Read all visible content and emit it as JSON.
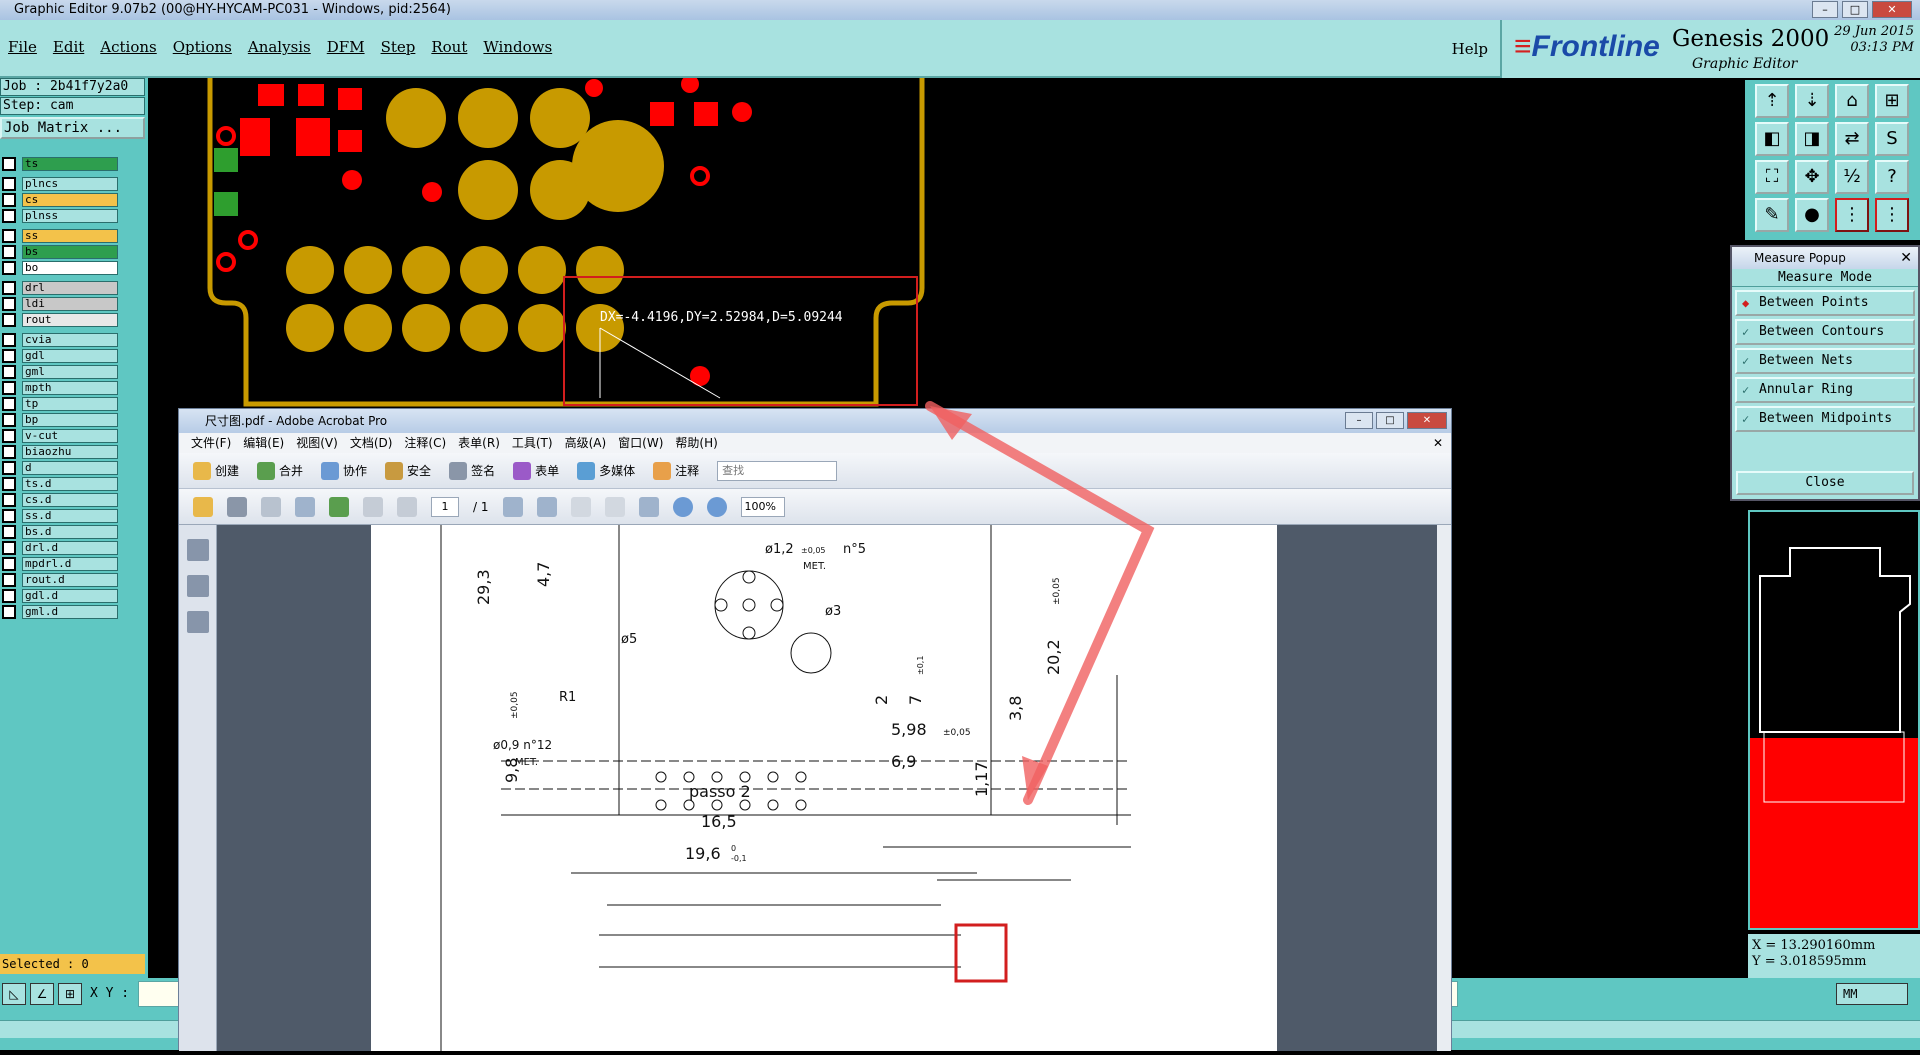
{
  "window": {
    "title": "Graphic Editor 9.07b2 (00@HY-HYCAM-PC031 - Windows, pid:2564)",
    "btn_min": "–",
    "btn_max": "□",
    "btn_close": "✕"
  },
  "menu": {
    "items": [
      "File",
      "Edit",
      "Actions",
      "Options",
      "Analysis",
      "DFM",
      "Step",
      "Rout",
      "Windows"
    ],
    "help": "Help"
  },
  "brand": {
    "logo": "Frontline",
    "product": "Genesis 2000",
    "subtitle": "Graphic Editor",
    "date": "29 Jun 2015",
    "time": "03:13 PM"
  },
  "left": {
    "job": "Job : 2b41f7y2a0",
    "step": "Step: cam",
    "job_matrix": "Job Matrix ...",
    "layers": [
      {
        "name": "ts",
        "color": "#2e9e4e"
      },
      {
        "name": "plncs",
        "color": "#a8e2e0"
      },
      {
        "name": "cs",
        "color": "#f3c24a"
      },
      {
        "name": "plnss",
        "color": "#a8e2e0"
      },
      {
        "name": "ss",
        "color": "#f3c24a"
      },
      {
        "name": "bs",
        "color": "#2e9e4e"
      },
      {
        "name": "bo",
        "color": "#ffffff"
      },
      {
        "name": "drl",
        "color": "#c8c8c8"
      },
      {
        "name": "ldi",
        "color": "#c8c8c8"
      },
      {
        "name": "rout",
        "color": "#e8e8e8"
      },
      {
        "name": "cvia",
        "color": "#a8e2e0"
      },
      {
        "name": "gdl",
        "color": "#a8e2e0"
      },
      {
        "name": "gml",
        "color": "#a8e2e0"
      },
      {
        "name": "mpth",
        "color": "#a8e2e0"
      },
      {
        "name": "tp",
        "color": "#a8e2e0"
      },
      {
        "name": "bp",
        "color": "#a8e2e0"
      },
      {
        "name": "v-cut",
        "color": "#a8e2e0"
      },
      {
        "name": "biaozhu",
        "color": "#a8e2e0"
      },
      {
        "name": "d",
        "color": "#a8e2e0"
      },
      {
        "name": "ts.d",
        "color": "#a8e2e0"
      },
      {
        "name": "cs.d",
        "color": "#a8e2e0"
      },
      {
        "name": "ss.d",
        "color": "#a8e2e0"
      },
      {
        "name": "bs.d",
        "color": "#a8e2e0"
      },
      {
        "name": "drl.d",
        "color": "#a8e2e0"
      },
      {
        "name": "mpdrl.d",
        "color": "#a8e2e0"
      },
      {
        "name": "rout.d",
        "color": "#a8e2e0"
      },
      {
        "name": "gdl.d",
        "color": "#a8e2e0"
      },
      {
        "name": "gml.d",
        "color": "#a8e2e0"
      }
    ],
    "selected": "Selected : 0"
  },
  "bottom": {
    "xy_label": "X Y :",
    "unit": "MM"
  },
  "measure_popup": {
    "title": "Measure Popup",
    "mode_label": "Measure Mode",
    "options": [
      "Between Points",
      "Between Contours",
      "Between Nets",
      "Annular Ring",
      "Between Midpoints"
    ],
    "selected_index": 0,
    "close": "Close"
  },
  "coords": {
    "x": "X  = 13.290160mm",
    "y": "Y  = 3.018595mm"
  },
  "measure_readout": "DX=-4.4196,DY=2.52984,D=5.09244",
  "acrobat": {
    "title": "尺寸图.pdf - Adobe Acrobat Pro",
    "menu": [
      "文件(F)",
      "编辑(E)",
      "视图(V)",
      "文档(D)",
      "注释(C)",
      "表单(R)",
      "工具(T)",
      "高级(A)",
      "窗口(W)",
      "帮助(H)"
    ],
    "toolbar": [
      "创建",
      "合并",
      "协作",
      "安全",
      "签名",
      "表单",
      "多媒体",
      "注释"
    ],
    "find_placeholder": "查找",
    "page_current": "1",
    "page_total": "/ 1",
    "zoom": "100%"
  },
  "drawing": {
    "dims": [
      "29,3",
      "4,7",
      "9,8",
      "±0,05",
      "20,2",
      "±0,05",
      "ø1,2",
      "±0,05",
      "n°5",
      "MET.",
      "ø3",
      "ø5",
      "R1",
      "2",
      "7",
      "±0,1",
      "3,8",
      "5,98",
      "±0,05",
      "6,9",
      "1,17",
      "ø0,9 n°12",
      "MET.",
      "passo 2",
      "16,5",
      "19,6",
      "0",
      "-0,1"
    ]
  }
}
